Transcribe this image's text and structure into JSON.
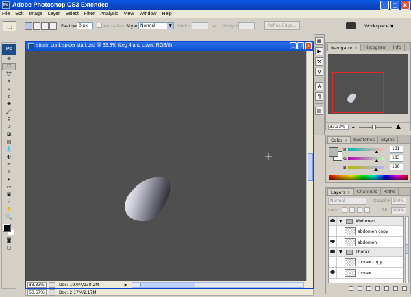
{
  "app": {
    "title": "Adobe Photoshop CS3 Extended",
    "logo": "Ps"
  },
  "window_controls": {
    "minimize": "_",
    "maximize": "□",
    "close": "x"
  },
  "menu": [
    "File",
    "Edit",
    "Image",
    "Layer",
    "Select",
    "Filter",
    "Analysis",
    "View",
    "Window",
    "Help"
  ],
  "options_bar": {
    "feather_label": "Feather:",
    "feather_value": "0 px",
    "antialias_label": "Anti-alias",
    "style_label": "Style:",
    "style_value": "Normal",
    "width_label": "Width:",
    "height_label": "Height:",
    "refine_edge": "Refine Edge...",
    "workspace_label": "Workspace ▼"
  },
  "document": {
    "title": "steam punk spider start.psd @ 33.3% (Leg 4 and cover, RGB/8)",
    "zoom": "33.33%",
    "doc_info": "Doc: 19.0M/130.2M",
    "canvas_color": "#4f4f4f"
  },
  "outer_status": {
    "zoom": "66.67%",
    "doc_info": "Doc: 2.17M/2.17M"
  },
  "navigator": {
    "tabs": [
      "Navigator",
      "Histogram",
      "Info"
    ],
    "zoom": "33.33%"
  },
  "color_panel": {
    "tabs": [
      "Color",
      "Swatches",
      "Styles"
    ],
    "r_label": "R",
    "r_value": "181",
    "g_label": "G",
    "g_value": "183",
    "b_label": "B",
    "b_value": "180"
  },
  "layers_panel": {
    "tabs": [
      "Layers",
      "Channels",
      "Paths"
    ],
    "blend_mode": "Normal",
    "opacity_label": "Opacity:",
    "opacity_value": "100%",
    "lock_label": "Lock:",
    "fill_label": "Fill:",
    "fill_value": "100%",
    "layers": [
      {
        "name": "Abdomen",
        "type": "group",
        "visible": true
      },
      {
        "name": "abdomen copy",
        "type": "layer",
        "visible": false
      },
      {
        "name": "abdomen",
        "type": "layer",
        "visible": true
      },
      {
        "name": "Thorax",
        "type": "group",
        "visible": true
      },
      {
        "name": "thorax copy",
        "type": "layer",
        "visible": false
      },
      {
        "name": "thorax",
        "type": "layer",
        "visible": true
      }
    ]
  },
  "colors": {
    "titlebar": "#0b47c6",
    "accent_red": "#e2262a"
  }
}
